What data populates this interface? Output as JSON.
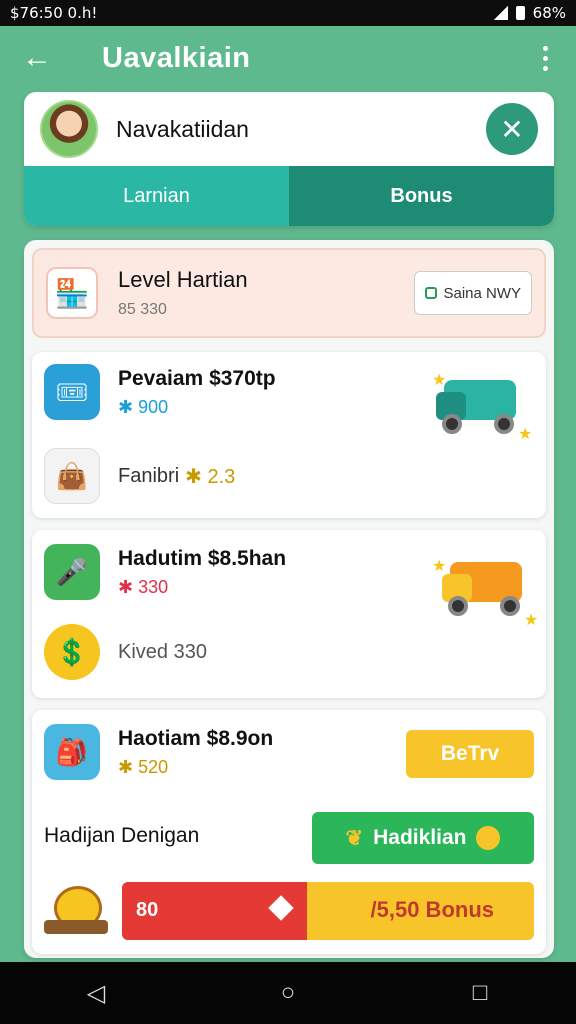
{
  "status_bar": {
    "time": "$76:50 0.h!",
    "battery": "68%"
  },
  "app_bar": {
    "title": "Uavalkiain"
  },
  "profile": {
    "name": "Navakatiidan",
    "close_symbol": "✕"
  },
  "tabs": [
    {
      "label": "Larnian"
    },
    {
      "label": "Bonus"
    }
  ],
  "level": {
    "title": "Level Hartian",
    "subtitle": "85 330",
    "button_label": "Saina NWY"
  },
  "items": [
    {
      "title": "Pevaiam $370tp",
      "sub": "✱ 900",
      "sub_color": "#1aa0d8",
      "secondary": "Fanibri",
      "secondary_value": "✱ 2.3"
    },
    {
      "title": "Hadutim $8.5han",
      "sub": "✱ 330",
      "sub_color": "#e0304a",
      "secondary": "Kived 330"
    },
    {
      "title": "Haotiam $8.9on",
      "sub": "✱ 520",
      "sub_color": "#c99a00",
      "button_label": "BeTrv"
    }
  ],
  "bottom": {
    "label": "Hadijan Denigan",
    "green_button": "Hadiklian",
    "progress_left": "80",
    "progress_right": "/5,50 Bonus",
    "progress_fraction": 0.45
  },
  "nav": {
    "back": "◁",
    "home": "○",
    "recents": "□"
  },
  "colors": {
    "background": "#5fb98e",
    "tab_left": "#2ab7a4",
    "tab_right": "#1e8b74",
    "accent_red": "#e53935",
    "accent_yellow": "#f7c52a",
    "accent_green": "#2cb65a"
  }
}
